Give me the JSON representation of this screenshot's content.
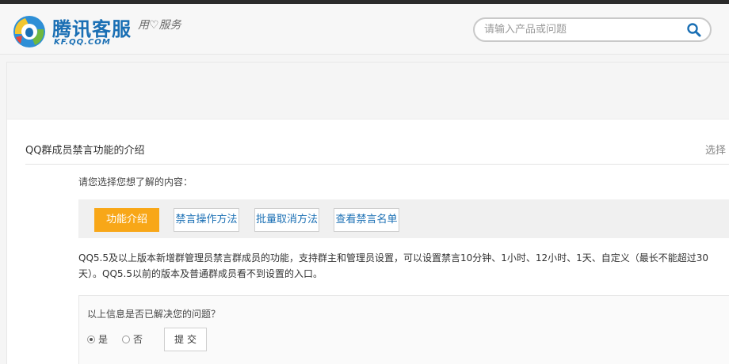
{
  "header": {
    "brand_cn": "腾讯客服",
    "brand_en": "KF.QQ.COM",
    "slogan": "用♡服务",
    "search": {
      "placeholder": "请输入产品或问题",
      "icon": "search-icon"
    }
  },
  "article": {
    "title": "QQ群成员禁言功能的介绍",
    "right_text": "选择"
  },
  "content": {
    "prompt": "请您选择您想了解的内容：",
    "tabs": [
      {
        "label": "功能介绍",
        "active": true
      },
      {
        "label": "禁言操作方法",
        "active": false
      },
      {
        "label": "批量取消方法",
        "active": false
      },
      {
        "label": "查看禁言名单",
        "active": false
      }
    ],
    "description": "QQ5.5及以上版本新增群管理员禁言群成员的功能，支持群主和管理员设置，可以设置禁言10分钟、1小时、12小时、1天、自定义（最长不能超过30天）。QQ5.5以前的版本及普通群成员看不到设置的入口。"
  },
  "feedback": {
    "question": "以上信息是否已解决您的问题？",
    "options": [
      {
        "label": "是",
        "checked": true
      },
      {
        "label": "否",
        "checked": false
      }
    ],
    "submit": "提交"
  },
  "colors": {
    "accent": "#f8a718",
    "link": "#1a6fb4",
    "topbar": "#2b2b2b"
  }
}
